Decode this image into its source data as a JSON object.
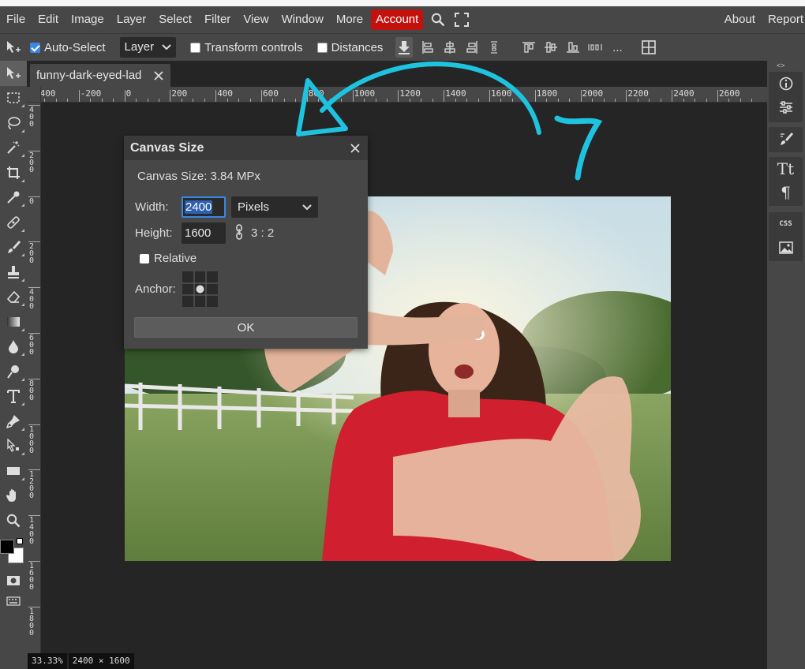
{
  "menu": {
    "items": [
      "File",
      "Edit",
      "Image",
      "Layer",
      "Select",
      "Filter",
      "View",
      "Window",
      "More"
    ],
    "account": "Account",
    "right_items": [
      "About",
      "Report"
    ]
  },
  "options": {
    "auto_select_label": "Auto-Select",
    "auto_select_checked": true,
    "layer_select": "Layer",
    "transform_label": "Transform controls",
    "distances_label": "Distances",
    "more_label": "..."
  },
  "tab": {
    "title": "funny-dark-eyed-lad"
  },
  "ruler": {
    "h_labels": [
      "-400",
      "-200",
      "0",
      "200",
      "400",
      "600",
      "800",
      "1000",
      "1200",
      "1400",
      "1600",
      "1800",
      "2000",
      "2200",
      "2400",
      "2600"
    ],
    "v_labels": [
      "400",
      "200",
      "0",
      "200",
      "400",
      "600",
      "800",
      "1000",
      "1200",
      "1400",
      "1600",
      "1800"
    ]
  },
  "dialog": {
    "title": "Canvas Size",
    "info": "Canvas Size: 3.84 MPx",
    "width_label": "Width:",
    "width_value": "2400",
    "unit": "Pixels",
    "height_label": "Height:",
    "height_value": "1600",
    "ratio": "3 : 2",
    "relative_label": "Relative",
    "relative_checked": false,
    "anchor_label": "Anchor:",
    "ok_label": "OK"
  },
  "status": {
    "zoom": "33.33%",
    "size": "2400 × 1600"
  },
  "colors": {
    "accent": "#3b87e4",
    "account": "#c3120e",
    "annotation": "#1ec3e0",
    "panel": "#474747",
    "background": "#252525"
  },
  "icons": {
    "toolbar": [
      "move-tool-icon",
      "marquee-icon",
      "lasso-icon",
      "magic-wand-icon",
      "crop-icon",
      "eyedropper-icon",
      "healing-icon",
      "brush-icon",
      "stamp-icon",
      "eraser-icon",
      "gradient-icon",
      "blur-icon",
      "dodge-icon",
      "type-icon",
      "pen-icon",
      "path-select-icon",
      "shape-icon",
      "hand-icon",
      "zoom-icon"
    ],
    "right_panel": [
      "info-icon",
      "adjustments-icon",
      "brush-settings-icon",
      "character-icon",
      "paragraph-icon",
      "css-icon",
      "image-icon"
    ]
  }
}
